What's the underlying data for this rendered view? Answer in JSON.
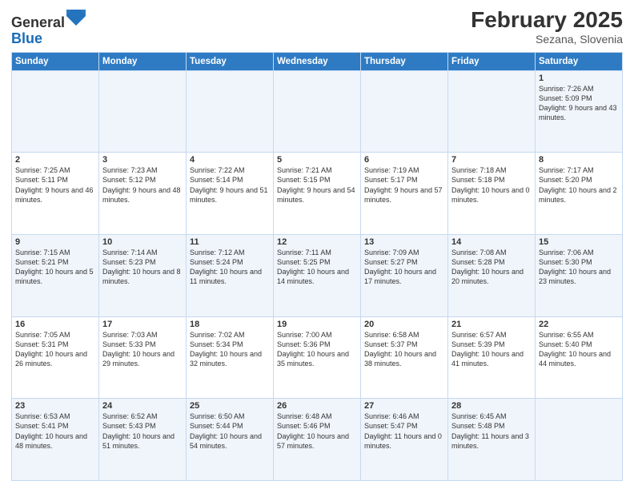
{
  "header": {
    "logo_general": "General",
    "logo_blue": "Blue",
    "month": "February 2025",
    "location": "Sezana, Slovenia"
  },
  "weekdays": [
    "Sunday",
    "Monday",
    "Tuesday",
    "Wednesday",
    "Thursday",
    "Friday",
    "Saturday"
  ],
  "weeks": [
    [
      {
        "day": "",
        "info": ""
      },
      {
        "day": "",
        "info": ""
      },
      {
        "day": "",
        "info": ""
      },
      {
        "day": "",
        "info": ""
      },
      {
        "day": "",
        "info": ""
      },
      {
        "day": "",
        "info": ""
      },
      {
        "day": "1",
        "info": "Sunrise: 7:26 AM\nSunset: 5:09 PM\nDaylight: 9 hours and 43 minutes."
      }
    ],
    [
      {
        "day": "2",
        "info": "Sunrise: 7:25 AM\nSunset: 5:11 PM\nDaylight: 9 hours and 46 minutes."
      },
      {
        "day": "3",
        "info": "Sunrise: 7:23 AM\nSunset: 5:12 PM\nDaylight: 9 hours and 48 minutes."
      },
      {
        "day": "4",
        "info": "Sunrise: 7:22 AM\nSunset: 5:14 PM\nDaylight: 9 hours and 51 minutes."
      },
      {
        "day": "5",
        "info": "Sunrise: 7:21 AM\nSunset: 5:15 PM\nDaylight: 9 hours and 54 minutes."
      },
      {
        "day": "6",
        "info": "Sunrise: 7:19 AM\nSunset: 5:17 PM\nDaylight: 9 hours and 57 minutes."
      },
      {
        "day": "7",
        "info": "Sunrise: 7:18 AM\nSunset: 5:18 PM\nDaylight: 10 hours and 0 minutes."
      },
      {
        "day": "8",
        "info": "Sunrise: 7:17 AM\nSunset: 5:20 PM\nDaylight: 10 hours and 2 minutes."
      }
    ],
    [
      {
        "day": "9",
        "info": "Sunrise: 7:15 AM\nSunset: 5:21 PM\nDaylight: 10 hours and 5 minutes."
      },
      {
        "day": "10",
        "info": "Sunrise: 7:14 AM\nSunset: 5:23 PM\nDaylight: 10 hours and 8 minutes."
      },
      {
        "day": "11",
        "info": "Sunrise: 7:12 AM\nSunset: 5:24 PM\nDaylight: 10 hours and 11 minutes."
      },
      {
        "day": "12",
        "info": "Sunrise: 7:11 AM\nSunset: 5:25 PM\nDaylight: 10 hours and 14 minutes."
      },
      {
        "day": "13",
        "info": "Sunrise: 7:09 AM\nSunset: 5:27 PM\nDaylight: 10 hours and 17 minutes."
      },
      {
        "day": "14",
        "info": "Sunrise: 7:08 AM\nSunset: 5:28 PM\nDaylight: 10 hours and 20 minutes."
      },
      {
        "day": "15",
        "info": "Sunrise: 7:06 AM\nSunset: 5:30 PM\nDaylight: 10 hours and 23 minutes."
      }
    ],
    [
      {
        "day": "16",
        "info": "Sunrise: 7:05 AM\nSunset: 5:31 PM\nDaylight: 10 hours and 26 minutes."
      },
      {
        "day": "17",
        "info": "Sunrise: 7:03 AM\nSunset: 5:33 PM\nDaylight: 10 hours and 29 minutes."
      },
      {
        "day": "18",
        "info": "Sunrise: 7:02 AM\nSunset: 5:34 PM\nDaylight: 10 hours and 32 minutes."
      },
      {
        "day": "19",
        "info": "Sunrise: 7:00 AM\nSunset: 5:36 PM\nDaylight: 10 hours and 35 minutes."
      },
      {
        "day": "20",
        "info": "Sunrise: 6:58 AM\nSunset: 5:37 PM\nDaylight: 10 hours and 38 minutes."
      },
      {
        "day": "21",
        "info": "Sunrise: 6:57 AM\nSunset: 5:39 PM\nDaylight: 10 hours and 41 minutes."
      },
      {
        "day": "22",
        "info": "Sunrise: 6:55 AM\nSunset: 5:40 PM\nDaylight: 10 hours and 44 minutes."
      }
    ],
    [
      {
        "day": "23",
        "info": "Sunrise: 6:53 AM\nSunset: 5:41 PM\nDaylight: 10 hours and 48 minutes."
      },
      {
        "day": "24",
        "info": "Sunrise: 6:52 AM\nSunset: 5:43 PM\nDaylight: 10 hours and 51 minutes."
      },
      {
        "day": "25",
        "info": "Sunrise: 6:50 AM\nSunset: 5:44 PM\nDaylight: 10 hours and 54 minutes."
      },
      {
        "day": "26",
        "info": "Sunrise: 6:48 AM\nSunset: 5:46 PM\nDaylight: 10 hours and 57 minutes."
      },
      {
        "day": "27",
        "info": "Sunrise: 6:46 AM\nSunset: 5:47 PM\nDaylight: 11 hours and 0 minutes."
      },
      {
        "day": "28",
        "info": "Sunrise: 6:45 AM\nSunset: 5:48 PM\nDaylight: 11 hours and 3 minutes."
      },
      {
        "day": "",
        "info": ""
      }
    ]
  ]
}
